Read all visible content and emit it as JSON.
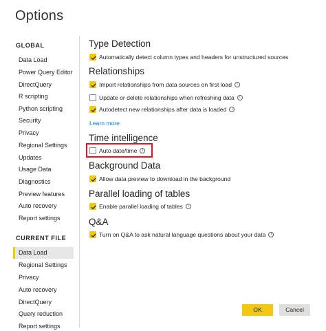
{
  "dialog": {
    "title": "Options"
  },
  "sidebar": {
    "global_heading": "GLOBAL",
    "global_items": [
      "Data Load",
      "Power Query Editor",
      "DirectQuery",
      "R scripting",
      "Python scripting",
      "Security",
      "Privacy",
      "Regional Settings",
      "Updates",
      "Usage Data",
      "Diagnostics",
      "Preview features",
      "Auto recovery",
      "Report settings"
    ],
    "current_heading": "CURRENT FILE",
    "current_items": [
      "Data Load",
      "Regional Settings",
      "Privacy",
      "Auto recovery",
      "DirectQuery",
      "Query reduction",
      "Report settings"
    ],
    "selected": "CURRENT FILE / Data Load"
  },
  "main": {
    "type_detection": {
      "title": "Type Detection",
      "options": [
        {
          "label": "Automatically detect column types and headers for unstructured sources",
          "checked": true
        }
      ]
    },
    "relationships": {
      "title": "Relationships",
      "options": [
        {
          "label": "Import relationships from data sources on first load",
          "checked": true,
          "info": true
        },
        {
          "label": "Update or delete relationships when refreshing data",
          "checked": false,
          "info": true
        },
        {
          "label": "Autodetect new relationships after data is loaded",
          "checked": true,
          "info": true
        }
      ],
      "learn_more": "Learn more"
    },
    "time_intelligence": {
      "title": "Time intelligence",
      "options": [
        {
          "label": "Auto date/time",
          "checked": false,
          "info": true
        }
      ]
    },
    "background_data": {
      "title": "Background Data",
      "options": [
        {
          "label": "Allow data preview to download in the background",
          "checked": true
        }
      ]
    },
    "parallel_loading": {
      "title": "Parallel loading of tables",
      "options": [
        {
          "label": "Enable parallel loading of tables",
          "checked": true,
          "info": true
        }
      ]
    },
    "qa": {
      "title": "Q&A",
      "options": [
        {
          "label": "Turn on Q&A to ask natural language questions about your data",
          "checked": true,
          "info": true
        }
      ]
    }
  },
  "footer": {
    "ok_label": "OK",
    "cancel_label": "Cancel"
  },
  "colors": {
    "accent": "#f2c811",
    "highlight_border": "#e81123",
    "link": "#0078d4"
  },
  "icons": {
    "checkbox_checked": "checkmark-icon",
    "info": "info-icon"
  }
}
